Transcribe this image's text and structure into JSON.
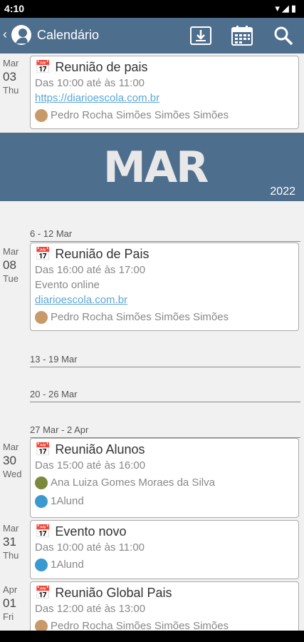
{
  "status": {
    "time": "4:10"
  },
  "appbar": {
    "title": "Calendário"
  },
  "banner": {
    "month": "MAR",
    "year": "2022"
  },
  "events": [
    {
      "month": "Mar",
      "day": "03",
      "weekday": "Thu",
      "title": "Reunião de pais",
      "time": "Das 10:00 até às 11:00",
      "link": "https://diarioescola.com.br",
      "person": "Pedro Rocha Simões Simões Simões"
    },
    {
      "month": "Mar",
      "day": "08",
      "weekday": "Tue",
      "title": "Reunião de Pais",
      "time": "Das 16:00 até às 17:00",
      "note": "Evento online",
      "link": "diarioescola.com.br",
      "person": "Pedro Rocha Simões Simões Simões"
    },
    {
      "month": "Mar",
      "day": "30",
      "weekday": "Wed",
      "title": "Reunião Alunos",
      "time": "Das 15:00 até às 16:00",
      "person": "Ana Luiza Gomes Moraes da Silva",
      "group": "1Alund"
    },
    {
      "month": "Mar",
      "day": "31",
      "weekday": "Thu",
      "title": "Evento novo",
      "time": "Das 10:00 até às 11:00",
      "group": "1Alund"
    },
    {
      "month": "Apr",
      "day": "01",
      "weekday": "Fri",
      "title": "Reunião Global Pais",
      "time": "Das 12:00 até às 13:00",
      "person": "Pedro Rocha Simões Simões Simões"
    }
  ],
  "weeks": [
    "6 - 12 Mar",
    "13 - 19 Mar",
    "20 - 26 Mar",
    "27 Mar - 2 Apr"
  ],
  "colors": {
    "primary": "#4e6e8e",
    "link": "#5aa7d9"
  }
}
